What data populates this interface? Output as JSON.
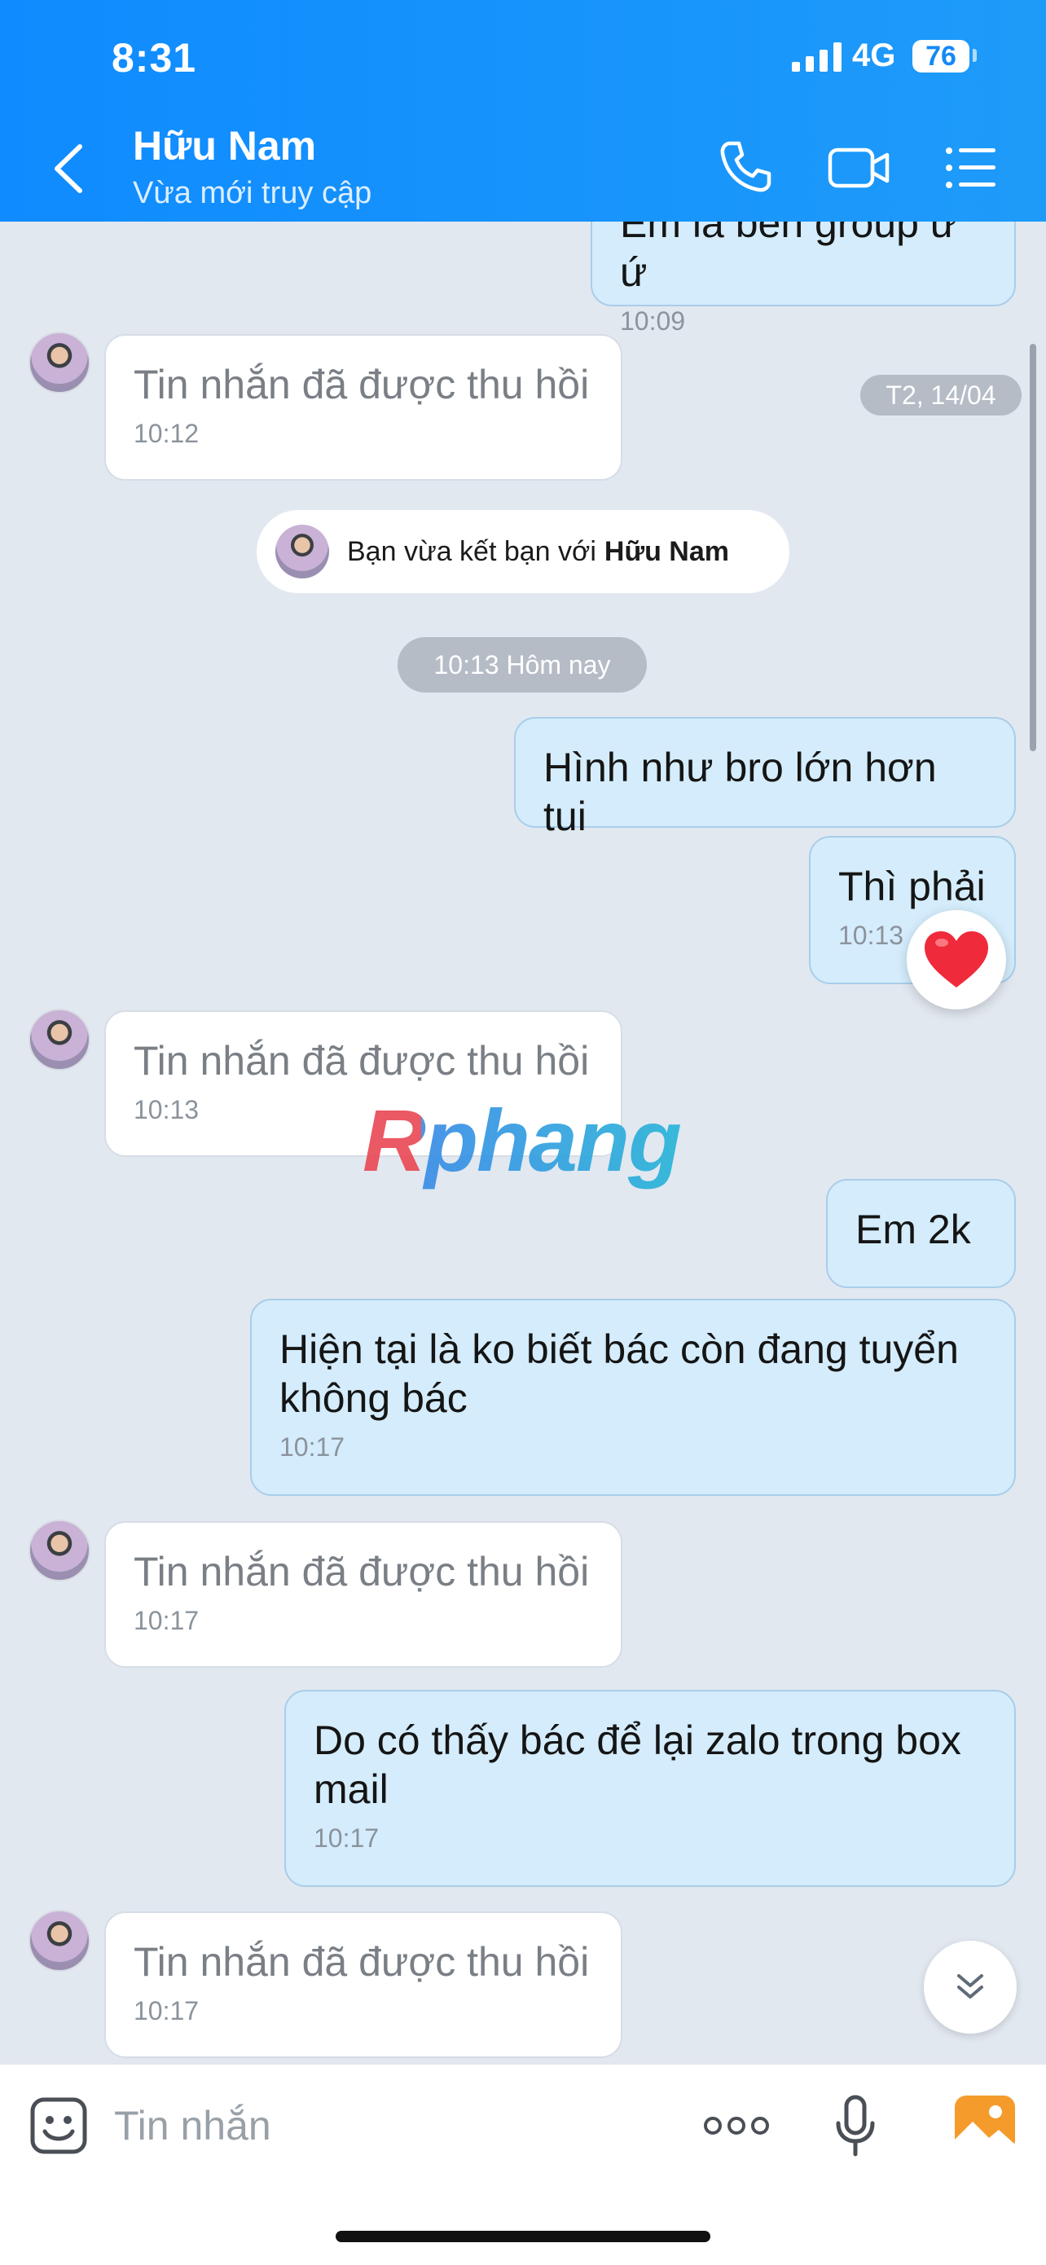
{
  "status_bar": {
    "time": "8:31",
    "network": "4G",
    "battery": "76"
  },
  "header": {
    "contact_name": "Hữu Nam",
    "contact_status": "Vừa mới truy cập",
    "icons": [
      "back-icon",
      "phone-icon",
      "video-call-icon",
      "menu-icon"
    ]
  },
  "messages": [
    {
      "dir": "out",
      "text": "Em là bên group ứ ứ",
      "time": "10:09"
    },
    {
      "dir": "in",
      "text": "Tin nhắn đã được thu hồi",
      "time": "10:12",
      "recalled": true
    },
    {
      "dir": "out",
      "text": "Hình như bro lớn hơn tui"
    },
    {
      "dir": "out",
      "text": "Thì phải",
      "time": "10:13",
      "reaction": "heart"
    },
    {
      "dir": "in",
      "text": "Tin nhắn đã được thu hồi",
      "time": "10:13",
      "recalled": true
    },
    {
      "dir": "out",
      "text": "Em 2k"
    },
    {
      "dir": "out",
      "text": "Hiện tại là ko biết bác còn đang tuyển không bác",
      "time": "10:17"
    },
    {
      "dir": "in",
      "text": "Tin nhắn đã được thu hồi",
      "time": "10:17",
      "recalled": true
    },
    {
      "dir": "out",
      "text": "Do có thấy bác để lại zalo trong box mail",
      "time": "10:17"
    },
    {
      "dir": "in",
      "text": "Tin nhắn đã được thu hồi",
      "time": "10:17",
      "recalled": true
    }
  ],
  "date_pill": "T2, 14/04",
  "system_message": {
    "prefix": "Bạn vừa kết bạn với",
    "name": "Hữu Nam"
  },
  "time_divider": "10:13 Hôm nay",
  "watermark": "Rphang",
  "input": {
    "placeholder": "Tin nhắn"
  },
  "colors": {
    "header_blue": "#0f8bff",
    "bubble_out": "#d4ecfb",
    "bubble_in": "#ffffff",
    "chat_bg": "#e2e8f0"
  }
}
